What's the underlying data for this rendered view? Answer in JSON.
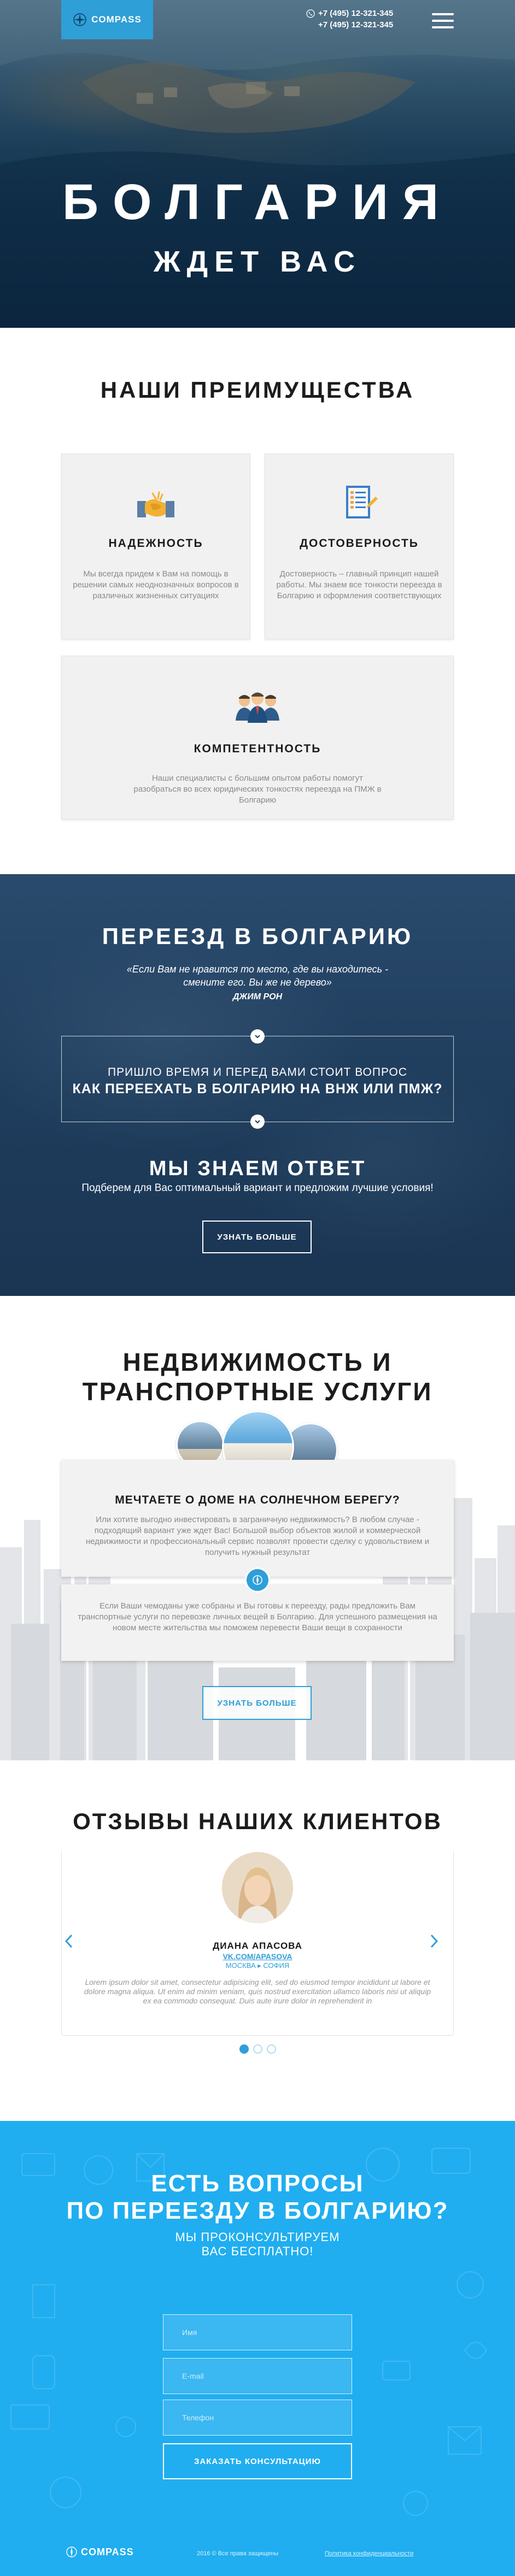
{
  "header": {
    "logo_text": "COMPASS",
    "phones": [
      "+7 (495) 12-321-345",
      "+7 (495) 12-321-345"
    ]
  },
  "hero": {
    "title": "БОЛГАРИЯ",
    "subtitle": "ЖДЕТ ВАС"
  },
  "advantages": {
    "title": "НАШИ ПРЕИМУЩЕСТВА",
    "items": [
      {
        "icon": "handshake-icon",
        "title": "НАДЕЖНОСТЬ",
        "text": "Мы всегда придем к Вам на помощь в решении самых неоднозначных вопросов в различных жизненных ситуациях"
      },
      {
        "icon": "document-icon",
        "title": "ДОСТОВЕРНОСТЬ",
        "text": "Достоверность – главный принцип нашей работы. Мы знаем все тонкости переезда в Болгарию и оформления соответствующих"
      },
      {
        "icon": "team-icon",
        "title": "КОМПЕТЕНТНОСТЬ",
        "text": "Наши специалисты с большим опытом работы помогут разобраться во всех юридических тонкостях переезда на ПМЖ в Болгарию"
      }
    ]
  },
  "move": {
    "title": "ПЕРЕЕЗД В БОЛГАРИЮ",
    "quote": "«Если Вам не нравится то место, где вы находитесь -\nсмените его. Вы же не дерево»",
    "quote_author": "ДЖИМ РОН",
    "question_line1": "ПРИШЛО ВРЕМЯ И ПЕРЕД ВАМИ СТОИТ ВОПРОС",
    "question_line2": "КАК ПЕРЕЕХАТЬ В БОЛГАРИЮ НА ВНЖ ИЛИ ПМЖ?",
    "answer_title": "МЫ ЗНАЕМ ОТВЕТ",
    "answer_sub": "Подберем для Вас оптимальный вариант и предложим лучшие условия!",
    "button": "УЗНАТЬ БОЛЬШЕ"
  },
  "realty": {
    "title_line1": "НЕДВИЖИМОСТЬ И",
    "title_line2": "ТРАНСПОРТНЫЕ УСЛУГИ",
    "card1_title": "МЕЧТАЕТЕ О ДОМЕ НА СОЛНЕЧНОМ БЕРЕГУ?",
    "card1_text": "Или хотите выгодно инвестировать в заграничную недвижимость? В любом случае - подходящий вариант уже ждет Вас! Большой выбор объектов жилой и коммерческой недвижимости и профессиональный сервис позволят провести сделку с удовольствием и получить нужный результат",
    "card2_text": "Если Ваши чемоданы уже собраны и Вы готовы к переезду, рады предложить Вам транспортные услуги по перевозке личных вещей в Болгарию. Для успешного размещения на новом месте жительства мы поможем перевести Ваши вещи в сохранности",
    "button": "УЗНАТЬ БОЛЬШЕ"
  },
  "reviews": {
    "title": "ОТЗЫВЫ НАШИХ КЛИЕНТОВ",
    "name": "ДИАНА АПАСОВА",
    "link": "VK.COM/APASOVA",
    "place": "МОСКВА  ▸  СОФИЯ",
    "text": "Lorem ipsum dolor sit amet, consectetur adipisicing elit, sed do eiusmod tempor incididunt ut labore et dolore magna aliqua. Ut enim ad minim veniam, quis nostrud exercitation ullamco laboris nisi ut aliquip ex ea commodo consequat. Duis aute irure dolor in reprehenderit in",
    "active_slide": 1,
    "slides": 3
  },
  "contact": {
    "title_line1": "ЕСТЬ ВОПРОСЫ",
    "title_line2": "ПО ПЕРЕЕЗДУ В БОЛГАРИЮ?",
    "sub_line1": "МЫ ПРОКОНСУЛЬТИРУЕМ",
    "sub_line2": "ВАС БЕСПЛАТНО!",
    "name_placeholder": "Имя",
    "email_placeholder": "E-mail",
    "phone_placeholder": "Телефон",
    "submit": "ЗАКАЗАТЬ КОНСУЛЬТАЦИЮ"
  },
  "footer": {
    "logo_text": "COMPASS",
    "copyright": "2016 © Все права защищены",
    "policy": "Политика конфиденциальности"
  },
  "colors": {
    "accent": "#2f9fd8",
    "contact_bg": "#20aef0",
    "dark_bg": "#1f3d5d"
  }
}
